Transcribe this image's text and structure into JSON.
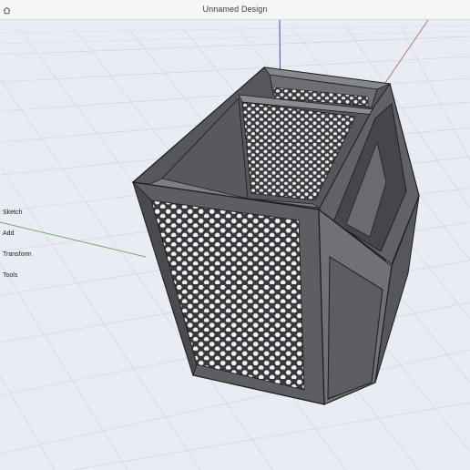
{
  "window": {
    "title": "Unnamed Design"
  },
  "toolbar": {
    "home_icon": "home-icon"
  },
  "menu": {
    "items": [
      {
        "label": "Sketch"
      },
      {
        "label": "Add"
      },
      {
        "label": "Transform"
      },
      {
        "label": "Tools"
      }
    ]
  },
  "colors": {
    "grid_background": "#e9edf3",
    "grid_line": "#c9d3df",
    "y_axis": "#4747c9",
    "x_axis": "#b76f66",
    "z_axis": "#6aa86a",
    "model_dark": "#4a4b4f",
    "model_mid": "#65666b",
    "model_light": "#7a7b80"
  }
}
